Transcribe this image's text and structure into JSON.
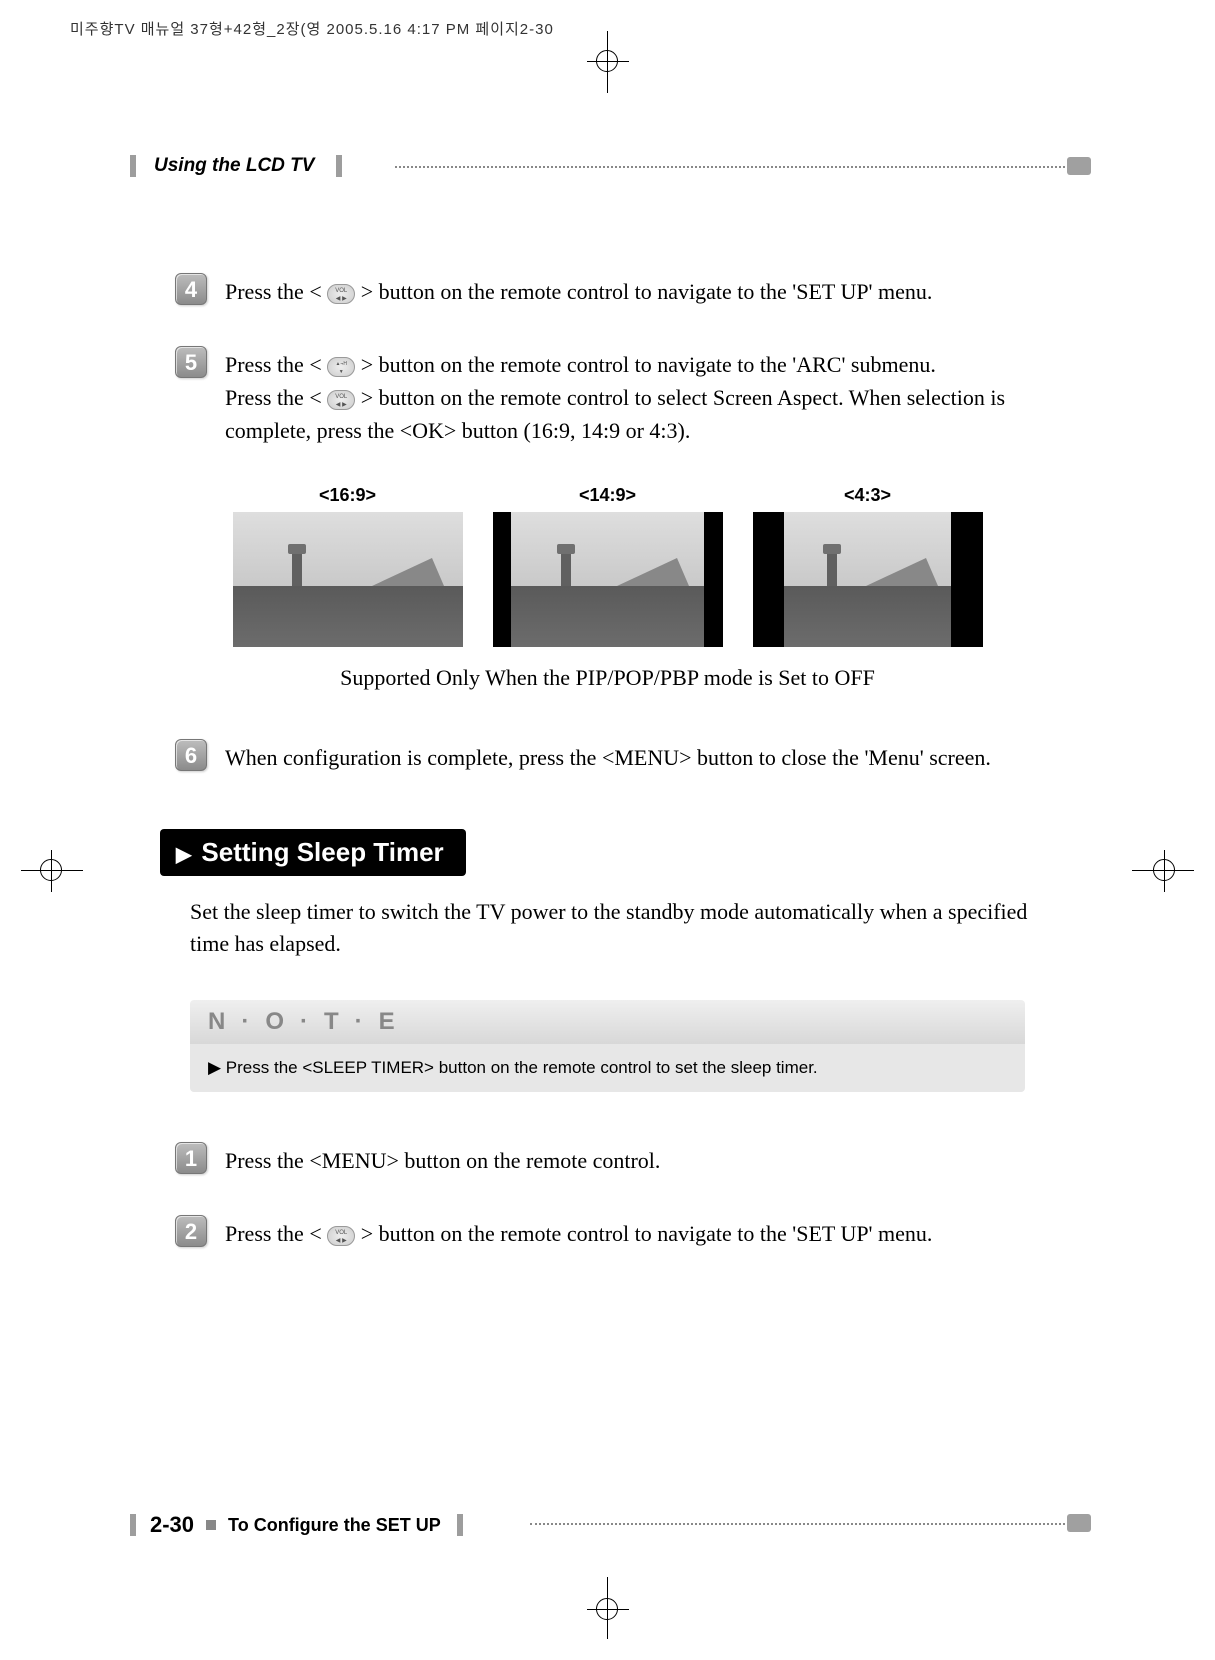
{
  "print_meta": "미주향TV 매뉴얼 37형+42형_2장(영  2005.5.16 4:17 PM  페이지2-30",
  "header": {
    "chapter_title": "Using the LCD TV"
  },
  "steps": {
    "s4": {
      "num": "4",
      "text_before": "Press the < ",
      "text_after": " > button on the remote control to navigate to the 'SET UP' menu."
    },
    "s5": {
      "num": "5",
      "line1_before": "Press the < ",
      "line1_after": " > button on the remote control to navigate to the 'ARC' submenu.",
      "line2_before": "Press the < ",
      "line2_after": " > button on the remote control to select Screen Aspect. When selection is complete, press the <OK> button (16:9, 14:9 or 4:3)."
    },
    "s6": {
      "num": "6",
      "text": "When configuration is complete, press the <MENU> button to close the 'Menu' screen."
    },
    "s1b": {
      "num": "1",
      "text": "Press the <MENU> button on the remote control."
    },
    "s2b": {
      "num": "2",
      "text_before": "Press the < ",
      "text_after": " > button on the remote control to navigate to the 'SET UP' menu."
    }
  },
  "aspects": {
    "a169": "<16:9>",
    "a149": "<14:9>",
    "a43": "<4:3>",
    "support_note": "Supported Only When the PIP/POP/PBP mode is Set to OFF"
  },
  "sleep_timer": {
    "heading": "Setting Sleep Timer",
    "intro": "Set the sleep timer to switch the TV power to the standby mode automatically when a specified time has elapsed."
  },
  "note": {
    "head": "N·O·T·E",
    "body": "Press the <SLEEP TIMER> button on the remote control to set the sleep timer."
  },
  "footer": {
    "page_num": "2-30",
    "section": "To Configure the SET UP"
  }
}
